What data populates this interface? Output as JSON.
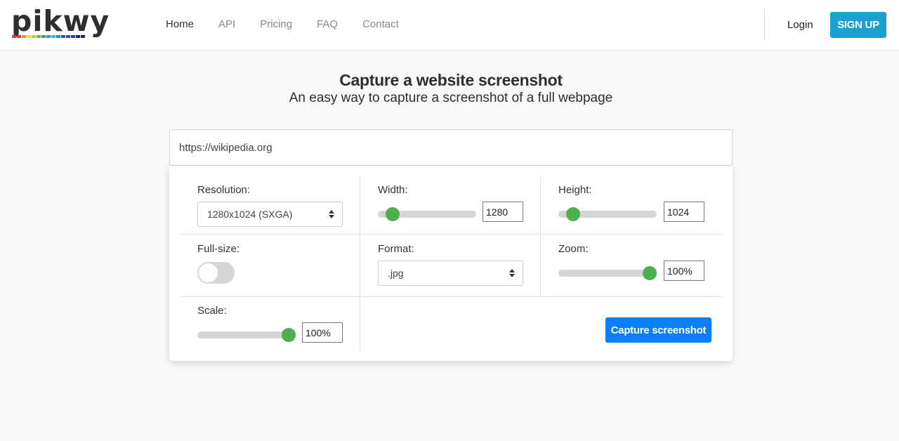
{
  "logo": {
    "text": "pikwy",
    "dot_colors": [
      "#e53935",
      "#e53935",
      "#fb8c00",
      "#fdd835",
      "#c0ca33",
      "#7cb342",
      "#43a047",
      "#26a69a",
      "#29b6f6",
      "#1e88e5",
      "#3949ab",
      "#3949ab",
      "#303f9f",
      "#1a237e",
      "#1a237e"
    ]
  },
  "nav": {
    "items": [
      {
        "label": "Home",
        "active": true
      },
      {
        "label": "API",
        "active": false
      },
      {
        "label": "Pricing",
        "active": false
      },
      {
        "label": "FAQ",
        "active": false
      },
      {
        "label": "Contact",
        "active": false
      }
    ],
    "login": "Login",
    "signup": "SIGN UP"
  },
  "hero": {
    "title": "Capture a website screenshot",
    "subtitle": "An easy way to capture a screenshot of a full webpage"
  },
  "form": {
    "url_value": "https://wikipedia.org",
    "resolution": {
      "label": "Resolution:",
      "value": "1280x1024 (SXGA)"
    },
    "width": {
      "label": "Width:",
      "value": "1280",
      "slider_fraction": 0.09
    },
    "height": {
      "label": "Height:",
      "value": "1024",
      "slider_fraction": 0.09
    },
    "fullsize": {
      "label": "Full-size:",
      "on": false
    },
    "format": {
      "label": "Format:",
      "value": ".jpg"
    },
    "zoom": {
      "label": "Zoom:",
      "value": "100%",
      "slider_fraction": 1.0
    },
    "scale": {
      "label": "Scale:",
      "value": "100%",
      "slider_fraction": 1.0
    },
    "capture_label": "Capture screenshot"
  },
  "colors": {
    "signup_bg": "#1aa1d2",
    "capture_bg": "#0d7ef8",
    "slider_thumb": "#4caf50"
  }
}
